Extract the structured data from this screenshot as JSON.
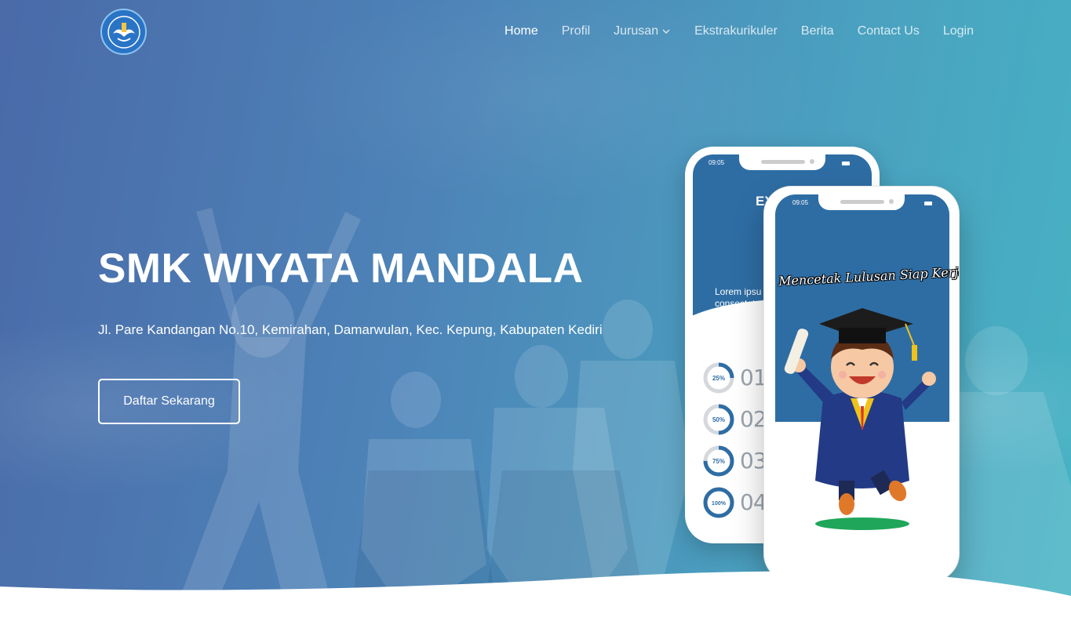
{
  "nav": {
    "logo_label": "TUT WURI HANDAYANI",
    "items": [
      {
        "label": "Home",
        "active": true
      },
      {
        "label": "Profil"
      },
      {
        "label": "Jurusan",
        "has_dropdown": true
      },
      {
        "label": "Ekstrakurikuler"
      },
      {
        "label": "Berita"
      },
      {
        "label": "Contact Us"
      },
      {
        "label": "Login"
      }
    ]
  },
  "hero": {
    "title": "SMK WIYATA MANDALA",
    "address": "Jl. Pare Kandangan No.10, Kemirahan, Damarwulan, Kec. Kepung, Kabupaten Kediri",
    "cta_label": "Daftar Sekarang"
  },
  "phone_back": {
    "time": "09:05",
    "header_text": "EX",
    "lorem_line1": "Lorem ipsu",
    "lorem_line2": "consectetu",
    "progress": [
      {
        "percent_label": "25%",
        "value": 0.25,
        "num": "01"
      },
      {
        "percent_label": "50%",
        "value": 0.5,
        "num": "02"
      },
      {
        "percent_label": "75%",
        "value": 0.75,
        "num": "03"
      },
      {
        "percent_label": "100%",
        "value": 1.0,
        "num": "04"
      }
    ]
  },
  "phone_front": {
    "time": "09:05",
    "tagline": "Mencetak Lulusan Siap Kerja"
  },
  "colors": {
    "accent": "#2e6da4",
    "hero_start": "#4a6aa8",
    "hero_end": "#47b3c4"
  }
}
